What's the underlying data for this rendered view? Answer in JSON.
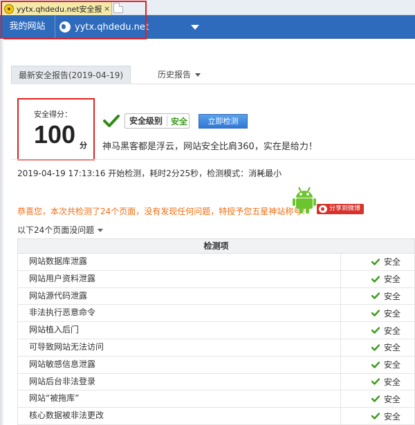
{
  "browser": {
    "tab_title": "yytx.qhdedu.net安全报告...",
    "tab_close": "×"
  },
  "sitebar": {
    "my_site": "我的网站",
    "site_name": "yytx.qhdedu.net"
  },
  "report_tabs": {
    "latest": "最新安全报告(2019-04-19)",
    "history": "历史报告"
  },
  "score": {
    "label": "安全得分：",
    "value": "100",
    "unit": "分"
  },
  "level": {
    "label": "安全级别",
    "value": "安全"
  },
  "scan_button": "立即检测",
  "slogan": "神马黑客都是浮云，网站安全比肩360，实在是给力！",
  "scan_info": "2019-04-19 17:13:16 开始检测，耗时2分25秒，检测模式：消耗最小",
  "congrats": "恭喜您，本次共检测了24个页面，没有发现任何问题，特授予您五星神站称号！",
  "share_label": "分享到微博",
  "no_issues": "以下24个页面没问题",
  "table": {
    "header": "检测项",
    "rows": [
      {
        "item": "网站数据库泄露",
        "status": "安全"
      },
      {
        "item": "网站用户资料泄露",
        "status": "安全"
      },
      {
        "item": "网站源代码泄露",
        "status": "安全"
      },
      {
        "item": "非法执行恶意命令",
        "status": "安全"
      },
      {
        "item": "网站植入后门",
        "status": "安全"
      },
      {
        "item": "可导致网站无法访问",
        "status": "安全"
      },
      {
        "item": "网站敏感信息泄露",
        "status": "安全"
      },
      {
        "item": "网站后台非法登录",
        "status": "安全"
      },
      {
        "item": "网站“被拖库”",
        "status": "安全"
      },
      {
        "item": "核心数据被非法更改",
        "status": "安全"
      }
    ]
  },
  "colors": {
    "sitebar": "#2f6bbd",
    "highlight": "#e02020",
    "safe_green": "#3a9a1a",
    "congrats_orange": "#f26d0f",
    "share_red": "#d9312b"
  }
}
